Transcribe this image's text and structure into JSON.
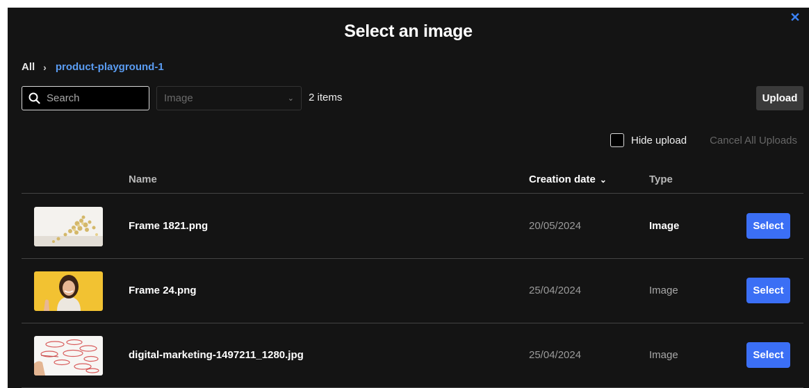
{
  "modal": {
    "title": "Select an image",
    "close_icon": "close-icon"
  },
  "breadcrumb": {
    "root": "All",
    "separator": "›",
    "current": "product-playground-1"
  },
  "toolbar": {
    "search_placeholder": "Search",
    "search_value": "",
    "type_filter_value": "Image",
    "items_count": "2 items",
    "upload_label": "Upload"
  },
  "upload_options": {
    "hide_upload_label": "Hide upload",
    "hide_upload_checked": false,
    "cancel_all_label": "Cancel All Uploads"
  },
  "table": {
    "columns": {
      "name": "Name",
      "creation_date": "Creation date",
      "type": "Type"
    },
    "rows": [
      {
        "name": "Frame 1821.png",
        "date": "20/05/2024",
        "type": "Image",
        "action": "Select",
        "thumbnail": "popcorn-image"
      },
      {
        "name": "Frame 24.png",
        "date": "25/04/2024",
        "type": "Image",
        "action": "Select",
        "thumbnail": "woman-portrait-image"
      },
      {
        "name": "digital-marketing-1497211_1280.jpg",
        "date": "25/04/2024",
        "type": "Image",
        "action": "Select",
        "thumbnail": "digital-marketing-image"
      }
    ]
  },
  "colors": {
    "background": "#141414",
    "accent": "#3b6ff5",
    "link": "#5a9cf2"
  }
}
